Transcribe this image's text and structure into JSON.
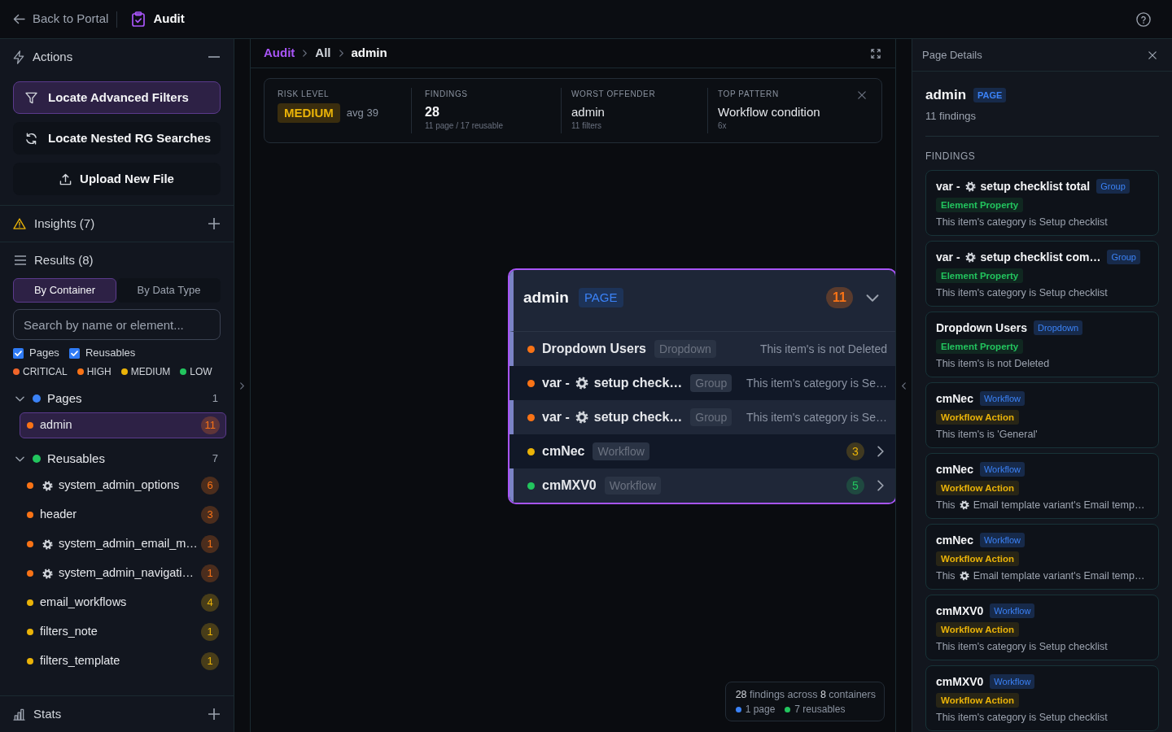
{
  "top_bar": {
    "back_link": "Back to Portal",
    "title": "Audit"
  },
  "sidebar": {
    "actions": {
      "title": "Actions",
      "expanded": true,
      "buttons": [
        {
          "kind": "filter",
          "label": "Locate Advanced Filters",
          "selected": true
        },
        {
          "kind": "refresh",
          "label": "Locate Nested RG Searches",
          "selected": false
        },
        {
          "kind": "upload",
          "label": "Upload New File",
          "selected": false
        }
      ]
    },
    "insights": {
      "title": "Insights (7)",
      "expanded": false
    },
    "results": {
      "title": "Results (8)",
      "tabs": [
        {
          "label": "By Container",
          "selected": true
        },
        {
          "label": "By Data Type",
          "selected": false
        }
      ],
      "search": {
        "placeholder": "Search by name or element..."
      },
      "filters": [
        {
          "label": "Pages",
          "checked": true
        },
        {
          "label": "Reusables",
          "checked": true
        }
      ],
      "legend": [
        {
          "label": "CRITICAL",
          "color": "#f0652a"
        },
        {
          "label": "HIGH",
          "color": "#f97316"
        },
        {
          "label": "MEDIUM",
          "color": "#eab308"
        },
        {
          "label": "LOW",
          "color": "#22c55e"
        }
      ],
      "tree": [
        {
          "label": "Pages",
          "count": "1",
          "color": "#3b82f6",
          "expanded": true,
          "children": [
            {
              "kind": "plain",
              "label": "admin",
              "count": "11",
              "color": "#f97316",
              "selected": true
            }
          ]
        },
        {
          "label": "Reusables",
          "count": "7",
          "color": "#22c55e",
          "expanded": true,
          "children": [
            {
              "kind": "component",
              "label": "system_admin_options",
              "count": "6",
              "color": "#f97316",
              "selected": false
            },
            {
              "kind": "plain",
              "label": "header",
              "count": "3",
              "color": "#f97316",
              "selected": false
            },
            {
              "kind": "component",
              "label": "system_admin_email_m…",
              "count": "1",
              "color": "#f97316",
              "selected": false
            },
            {
              "kind": "component",
              "label": "system_admin_navigati…",
              "count": "1",
              "color": "#f97316",
              "selected": false
            },
            {
              "kind": "plain",
              "label": "email_workflows",
              "count": "4",
              "color": "#eab308",
              "selected": false
            },
            {
              "kind": "plain",
              "label": "filters_note",
              "count": "1",
              "color": "#eab308",
              "selected": false
            },
            {
              "kind": "plain",
              "label": "filters_template",
              "count": "1",
              "color": "#eab308",
              "selected": false
            }
          ]
        }
      ]
    },
    "stats": {
      "title": "Stats",
      "expanded": false
    }
  },
  "canvas": {
    "breadcrumb": [
      {
        "label": "Audit"
      },
      {
        "label": "All"
      },
      {
        "label": "admin"
      }
    ],
    "summary": {
      "metrics": [
        {
          "kind": "risk",
          "label": "RISK LEVEL",
          "value": "MEDIUM",
          "detail": "avg 39"
        },
        {
          "kind": "number",
          "label": "FINDINGS",
          "value": "28",
          "detail": "11 page / 17 reusable"
        },
        {
          "kind": "text",
          "label": "WORST OFFENDER",
          "value": "admin",
          "detail": "11 filters"
        },
        {
          "kind": "text",
          "label": "TOP PATTERN",
          "value": "Workflow condition",
          "detail": "6x"
        }
      ]
    },
    "node": {
      "title": "admin",
      "type": "PAGE",
      "count": "11",
      "color": "#f97316",
      "expanded": true,
      "rows": [
        {
          "kind": "element",
          "name": "Dropdown Users",
          "type": "Dropdown",
          "description": "This item's is not Deleted",
          "color": "#f97316"
        },
        {
          "kind": "variable",
          "prefix": "var -",
          "name": "setup check…",
          "type": "Group",
          "description": "This item's category is Se…",
          "color": "#f97316"
        },
        {
          "kind": "variable",
          "prefix": "var -",
          "name": "setup check…",
          "type": "Group",
          "description": "This item's category is Se…",
          "color": "#f97316"
        },
        {
          "kind": "container",
          "name": "cmNec",
          "type": "Workflow",
          "count": "3",
          "color": "#eab308"
        },
        {
          "kind": "container",
          "name": "cmMXV0",
          "type": "Workflow",
          "count": "5",
          "color": "#22c55e"
        }
      ]
    },
    "totals": {
      "findings": "28",
      "findings_text": "findings across",
      "containers": "8",
      "containers_text": "containers",
      "legend": [
        {
          "label": "1 page",
          "color": "#3b82f6"
        },
        {
          "label": "7 reusables",
          "color": "#22c55e"
        }
      ]
    }
  },
  "details": {
    "title": "Page Details",
    "name": "admin",
    "type": "PAGE",
    "subtitle": "11 findings",
    "section": "FINDINGS",
    "findings": [
      {
        "kind": "variable",
        "prefix": "var -",
        "name": "setup checklist total",
        "type": "Group",
        "tag": {
          "label": "Element Property",
          "color": "#22c55e"
        },
        "description": "This item's category is Setup checklist"
      },
      {
        "kind": "variable",
        "prefix": "var -",
        "name": "setup checklist com…",
        "type": "Group",
        "tag": {
          "label": "Element Property",
          "color": "#22c55e"
        },
        "description": "This item's category is Setup checklist"
      },
      {
        "kind": "plain",
        "name": "Dropdown Users",
        "type": "Dropdown",
        "tag": {
          "label": "Element Property",
          "color": "#22c55e"
        },
        "description": "This item's is not Deleted"
      },
      {
        "kind": "plain",
        "name": "cmNec",
        "type": "Workflow",
        "tag": {
          "label": "Workflow Action",
          "color": "#eab308"
        },
        "description": "This item's is 'General'"
      },
      {
        "kind": "reference",
        "name": "cmNec",
        "type": "Workflow",
        "tag": {
          "label": "Workflow Action",
          "color": "#eab308"
        },
        "description_prefix": "This",
        "description": "Email template variant's Email temp…"
      },
      {
        "kind": "reference",
        "name": "cmNec",
        "type": "Workflow",
        "tag": {
          "label": "Workflow Action",
          "color": "#eab308"
        },
        "description_prefix": "This",
        "description": "Email template variant's Email temp…"
      },
      {
        "kind": "plain",
        "name": "cmMXV0",
        "type": "Workflow",
        "tag": {
          "label": "Workflow Action",
          "color": "#eab308"
        },
        "description": "This item's category is Setup checklist"
      },
      {
        "kind": "plain",
        "name": "cmMXV0",
        "type": "Workflow",
        "tag": {
          "label": "Workflow Action",
          "color": "#eab308"
        },
        "description": "This item's category is Setup checklist"
      }
    ]
  }
}
